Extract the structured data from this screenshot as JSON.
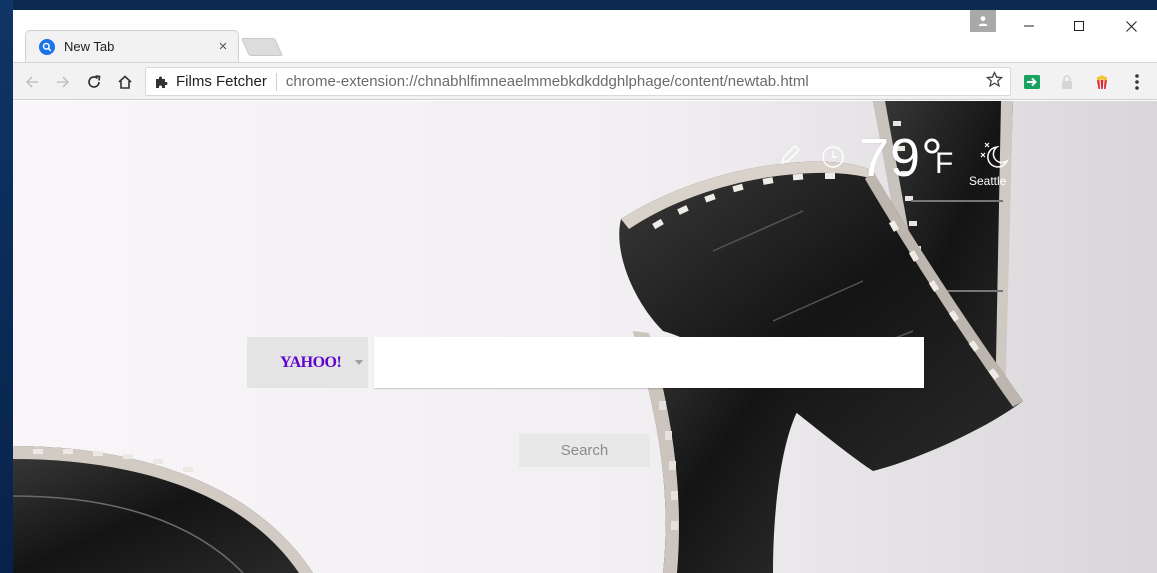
{
  "tab": {
    "title": "New Tab",
    "close": "×",
    "favicon": "search-icon"
  },
  "window_controls": {
    "minimize": "—",
    "maximize": "☐",
    "close": "✕"
  },
  "toolbar": {
    "back": "←",
    "forward": "→",
    "reload": "↻",
    "home": "⌂",
    "site_name": "Films Fetcher",
    "url": "chrome-extension://chnabhlfimneaelmmebkdkddghlphage/content/newtab.html",
    "star": "☆",
    "menu": "⋮"
  },
  "weather": {
    "temperature": "79°",
    "unit": "F",
    "city": "Seattle",
    "condition_icon": "moon-night-icon"
  },
  "search": {
    "engine": "YAHOO!",
    "placeholder": "",
    "button_label": "Search"
  },
  "colors": {
    "yahoo_purple": "#5f01d1",
    "ext_green": "#1aa260",
    "ext_red": "#d9262d"
  }
}
